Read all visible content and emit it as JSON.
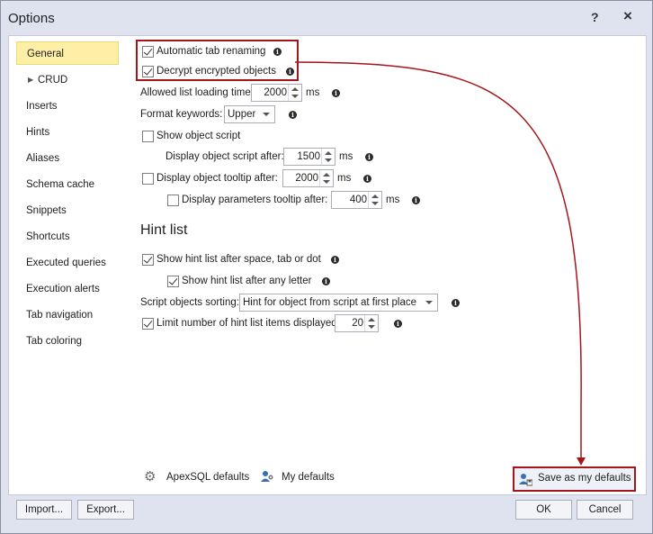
{
  "window": {
    "title": "Options",
    "help_label": "?",
    "close_label": "×"
  },
  "nav": {
    "items": [
      {
        "label": "General",
        "active": true
      },
      {
        "label": "CRUD",
        "expandable": true
      },
      {
        "label": "Inserts"
      },
      {
        "label": "Hints"
      },
      {
        "label": "Aliases"
      },
      {
        "label": "Schema cache"
      },
      {
        "label": "Snippets"
      },
      {
        "label": "Shortcuts"
      },
      {
        "label": "Executed queries"
      },
      {
        "label": "Execution alerts"
      },
      {
        "label": "Tab navigation"
      },
      {
        "label": "Tab coloring"
      }
    ]
  },
  "general": {
    "auto_tab_renaming": {
      "label": "Automatic tab renaming",
      "checked": true
    },
    "decrypt_objects": {
      "label": "Decrypt encrypted objects",
      "checked": true
    },
    "allowed_list_loading": {
      "label": "Allowed list loading time:",
      "value": "2000",
      "unit": "ms"
    },
    "format_keywords": {
      "label": "Format keywords:",
      "value": "Upper"
    },
    "show_object_script": {
      "label": "Show object script",
      "checked": false
    },
    "display_script_after": {
      "label": "Display object script after:",
      "value": "1500",
      "unit": "ms"
    },
    "display_tooltip_after": {
      "label": "Display object tooltip after:",
      "value": "2000",
      "unit": "ms",
      "checked": false
    },
    "display_params_tooltip": {
      "label": "Display parameters tooltip after:",
      "value": "400",
      "unit": "ms",
      "checked": false
    }
  },
  "hint_list": {
    "heading": "Hint list",
    "show_after_space": {
      "label": "Show hint list after space, tab or dot",
      "checked": true
    },
    "show_after_letter": {
      "label": "Show hint list after any letter",
      "checked": true
    },
    "sorting": {
      "label": "Script objects sorting:",
      "value": "Hint for object from script at first place"
    },
    "limit_items": {
      "label": "Limit number of hint list items displayed:",
      "value": "20",
      "checked": true
    }
  },
  "footer": {
    "apexsql_defaults": "ApexSQL defaults",
    "my_defaults": "My defaults",
    "save_as_my_defaults": "Save as my defaults",
    "import": "Import...",
    "export": "Export...",
    "ok": "OK",
    "cancel": "Cancel"
  },
  "colors": {
    "accent_red": "#a4161a",
    "active_nav": "#fdf0a6"
  }
}
